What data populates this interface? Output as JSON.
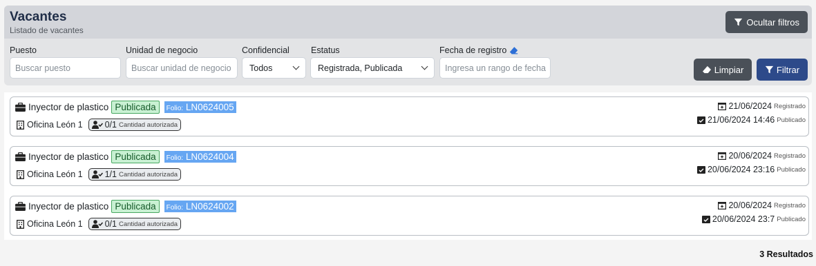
{
  "header": {
    "title": "Vacantes",
    "subtitle": "Listado de vacantes",
    "hide_filters_label": "Ocultar filtros"
  },
  "filters": {
    "puesto": {
      "label": "Puesto",
      "placeholder": "Buscar puesto"
    },
    "unidad": {
      "label": "Unidad de negocio",
      "placeholder": "Buscar unidad de negocio"
    },
    "confidencial": {
      "label": "Confidencial",
      "value": "Todos"
    },
    "estatus": {
      "label": "Estatus",
      "value": "Registrada, Publicada"
    },
    "fecha": {
      "label": "Fecha de registro",
      "placeholder": "Ingresa un rango de fecha"
    },
    "clear_label": "Limpiar",
    "filter_label": "Filtrar"
  },
  "vacancies": [
    {
      "position": "Inyector de plastico",
      "status": "Publicada",
      "folio_prefix": "Folio:",
      "folio": "LN0624005",
      "office": "Oficina León 1",
      "quantity": "0/1",
      "quantity_label": "Cantidad autorizada",
      "registered_date": "21/06/2024",
      "registered_label": "Registrado",
      "published_date": "21/06/2024 14:46",
      "published_label": "Publicado"
    },
    {
      "position": "Inyector de plastico",
      "status": "Publicada",
      "folio_prefix": "Folio:",
      "folio": "LN0624004",
      "office": "Oficina León 1",
      "quantity": "1/1",
      "quantity_label": "Cantidad autorizada",
      "registered_date": "20/06/2024",
      "registered_label": "Registrado",
      "published_date": "20/06/2024 23:16",
      "published_label": "Publicado"
    },
    {
      "position": "Inyector de plastico",
      "status": "Publicada",
      "folio_prefix": "Folio:",
      "folio": "LN0624002",
      "office": "Oficina León 1",
      "quantity": "0/1",
      "quantity_label": "Cantidad autorizada",
      "registered_date": "20/06/2024",
      "registered_label": "Registrado",
      "published_date": "20/06/2024 23:7",
      "published_label": "Publicado"
    }
  ],
  "results_text": "3 Resultados",
  "icons": {
    "filter": "filter-icon",
    "eraser": "eraser-icon",
    "briefcase": "briefcase-icon",
    "building": "building-icon",
    "user_check": "user-check-icon",
    "calendar_plus": "calendar-plus-icon",
    "calendar_check": "calendar-check-icon",
    "chevron": "chevron-down-icon"
  },
  "colors": {
    "primary": "#2d4a8a",
    "secondary": "#4a5058",
    "published_bg": "#c9f1d3",
    "published_border": "#47a760",
    "folio_bg": "#66a6f2"
  }
}
